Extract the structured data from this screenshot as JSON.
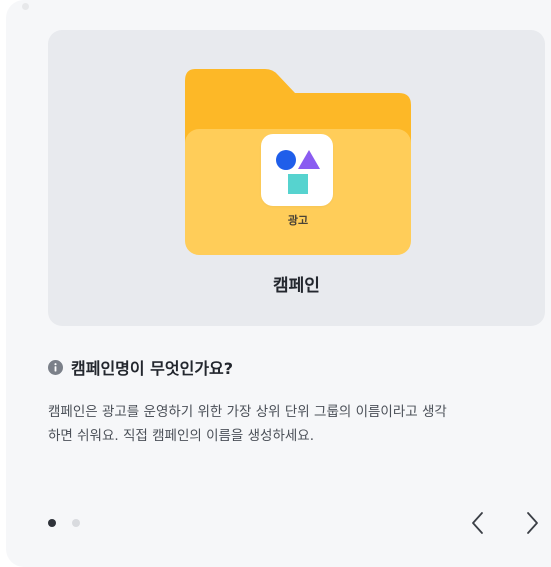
{
  "preview": {
    "tile_label": "광고",
    "caption": "캠페인"
  },
  "help": {
    "question": "캠페인명이 무엇인가요?",
    "description_line1": "캠페인은 광고를 운영하기 위한 가장 상위 단위 그룹의 이름이라고 생각",
    "description_line2": "하면 쉬워요. 직접 캠페인의 이름을 생성하세요."
  },
  "pager": {
    "total": 2,
    "current": 1
  },
  "colors": {
    "folder_back": "#fdb827",
    "folder_front": "#ffcd59",
    "circle": "#1f5eea",
    "triangle": "#8a5cf1",
    "square": "#56d3cf"
  },
  "icons": {
    "info": "info-circle-icon",
    "prev": "chevron-left-icon",
    "next": "chevron-right-icon"
  }
}
